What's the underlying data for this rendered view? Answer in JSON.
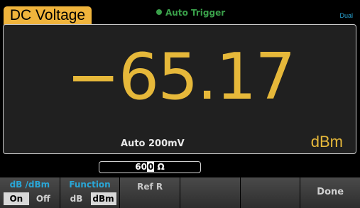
{
  "header": {
    "mode_label": "DC Voltage",
    "trigger_label": "Auto Trigger",
    "dual_label": "Dual"
  },
  "display": {
    "reading": "−65.17",
    "range": "Auto 200mV",
    "unit": "dBm"
  },
  "entry": {
    "value_prefix": "60",
    "value_cursor": "0",
    "value_suffix": " Ω"
  },
  "softkeys": {
    "dbdbm": {
      "title": "dB /dBm",
      "options": [
        "On",
        "Off"
      ],
      "selected": "On"
    },
    "function": {
      "title": "Function",
      "options": [
        "dB",
        "dBm"
      ],
      "selected": "dBm"
    },
    "refr": {
      "title": "Ref R"
    },
    "done": {
      "label": "Done"
    }
  },
  "colors": {
    "accent": "#e6b83a",
    "trigger": "#3aa04a",
    "softkey_title": "#2aa6d6"
  }
}
